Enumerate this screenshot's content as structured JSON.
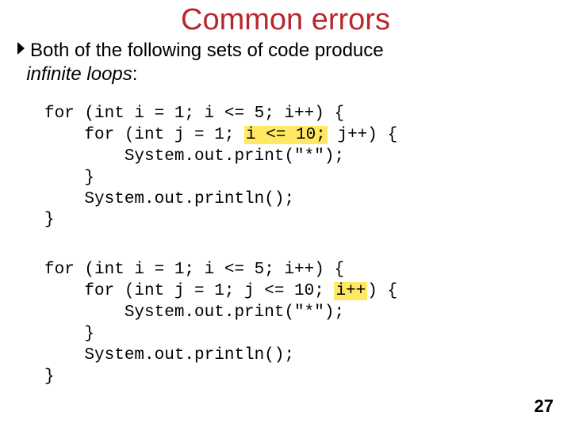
{
  "title": "Common errors",
  "intro": {
    "line1_prefix": "Both of the following sets of code produce",
    "line2_italic": "infinite loops",
    "line2_suffix": ":"
  },
  "code1": {
    "l1a": "for (int i = 1; i <= 5; i++) {",
    "l2a": "    for (int j = 1; ",
    "l2hl": "i <= 10;",
    "l2b": " j++) {",
    "l3": "        System.out.print(\"*\");",
    "l4": "    }",
    "l5": "    System.out.println();",
    "l6": "}"
  },
  "code2": {
    "l1": "for (int i = 1; i <= 5; i++) {",
    "l2a": "    for (int j = 1; j <= 10; ",
    "l2hl": "i++",
    "l2b": ") {",
    "l3": "        System.out.print(\"*\");",
    "l4": "    }",
    "l5": "    System.out.println();",
    "l6": "}"
  },
  "page_number": "27"
}
